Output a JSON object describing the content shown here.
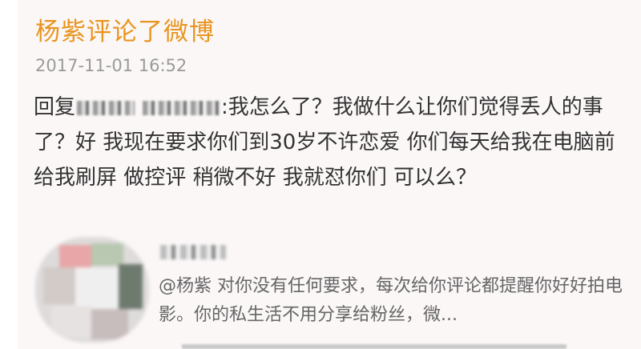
{
  "card": {
    "title": "杨紫评论了微博",
    "timestamp": "2017-11-01 16:52"
  },
  "comment": {
    "reply_prefix": "回复",
    "text": ":我怎么了？我做什么让你们觉得丢人的事了？好 我现在要求你们到30岁不许恋爱 你们每天给我在电脑前 给我刷屏 做控评 稍微不好 我就怼你们 可以么？"
  },
  "reply": {
    "text": "@杨紫  对你没有任何要求，每次给你评论都提醒你好好拍电影。你的私生活不用分享给粉丝，微..."
  }
}
